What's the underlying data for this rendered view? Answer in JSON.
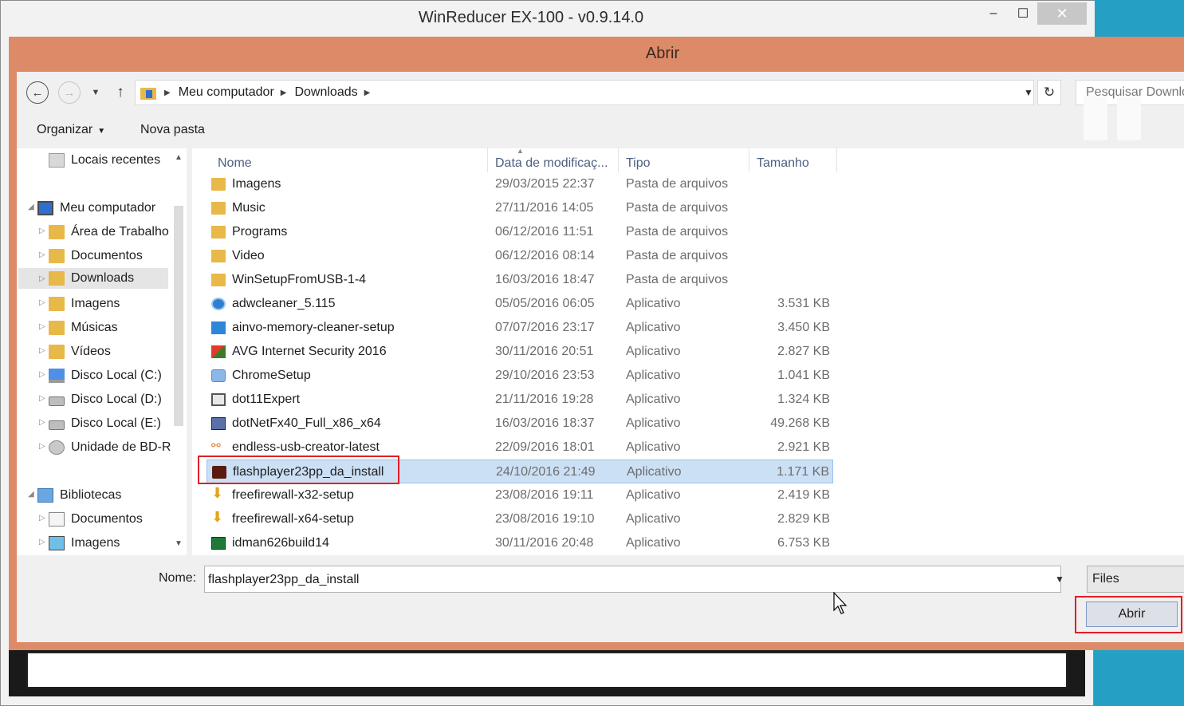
{
  "app": {
    "title": "WinReducer EX-100 - v0.9.14.0",
    "buttons": {
      "minimize": "–",
      "maximize": "☐",
      "close": "✕"
    }
  },
  "dialog": {
    "title": "Abrir",
    "address": {
      "crumbs": [
        "Meu computador",
        "Downloads"
      ]
    },
    "search_placeholder": "Pesquisar Downloads",
    "toolbar": {
      "organize": "Organizar",
      "new_folder": "Nova pasta"
    },
    "nav_pane": {
      "items": [
        {
          "label": "Locais recentes",
          "icon": "recent-places-icon"
        },
        {
          "label": "Meu computador",
          "icon": "computer-icon"
        },
        {
          "label": "Área de Trabalho",
          "icon": "desktop-folder-icon"
        },
        {
          "label": "Documentos",
          "icon": "documents-folder-icon"
        },
        {
          "label": "Downloads",
          "icon": "downloads-folder-icon",
          "selected": true
        },
        {
          "label": "Imagens",
          "icon": "pictures-folder-icon"
        },
        {
          "label": "Músicas",
          "icon": "music-folder-icon"
        },
        {
          "label": "Vídeos",
          "icon": "videos-folder-icon"
        },
        {
          "label": "Disco Local (C:)",
          "icon": "system-drive-icon"
        },
        {
          "label": "Disco Local (D:)",
          "icon": "drive-icon"
        },
        {
          "label": "Disco Local (E:)",
          "icon": "drive-icon"
        },
        {
          "label": "Unidade de BD-R",
          "icon": "disc-drive-icon"
        },
        {
          "label": "Bibliotecas",
          "icon": "libraries-icon"
        },
        {
          "label": "Documentos",
          "icon": "documents-library-icon"
        },
        {
          "label": "Imagens",
          "icon": "pictures-library-icon"
        }
      ]
    },
    "columns": {
      "name": "Nome",
      "date": "Data de modificaç...",
      "type": "Tipo",
      "size": "Tamanho"
    },
    "files": [
      {
        "name": "Imagens",
        "date": "29/03/2015 22:37",
        "type": "Pasta de arquivos",
        "size": "",
        "icon": "folder-icon"
      },
      {
        "name": "Music",
        "date": "27/11/2016 14:05",
        "type": "Pasta de arquivos",
        "size": "",
        "icon": "folder-icon"
      },
      {
        "name": "Programs",
        "date": "06/12/2016 11:51",
        "type": "Pasta de arquivos",
        "size": "",
        "icon": "folder-icon"
      },
      {
        "name": "Video",
        "date": "06/12/2016 08:14",
        "type": "Pasta de arquivos",
        "size": "",
        "icon": "folder-icon"
      },
      {
        "name": "WinSetupFromUSB-1-4",
        "date": "16/03/2016 18:47",
        "type": "Pasta de arquivos",
        "size": "",
        "icon": "folder-icon"
      },
      {
        "name": "adwcleaner_5.115",
        "date": "05/05/2016 06:05",
        "type": "Aplicativo",
        "size": "3.531 KB",
        "icon": "adwcleaner-icon"
      },
      {
        "name": "ainvo-memory-cleaner-setup",
        "date": "07/07/2016 23:17",
        "type": "Aplicativo",
        "size": "3.450 KB",
        "icon": "memory-cleaner-icon"
      },
      {
        "name": "AVG Internet Security 2016",
        "date": "30/11/2016 20:51",
        "type": "Aplicativo",
        "size": "2.827 KB",
        "icon": "avg-icon"
      },
      {
        "name": "ChromeSetup",
        "date": "29/10/2016 23:53",
        "type": "Aplicativo",
        "size": "1.041 KB",
        "icon": "chrome-setup-icon"
      },
      {
        "name": "dot11Expert",
        "date": "21/11/2016 19:28",
        "type": "Aplicativo",
        "size": "1.324 KB",
        "icon": "application-icon"
      },
      {
        "name": "dotNetFx40_Full_x86_x64",
        "date": "16/03/2016 18:37",
        "type": "Aplicativo",
        "size": "49.268 KB",
        "icon": "dotnet-installer-icon"
      },
      {
        "name": "endless-usb-creator-latest",
        "date": "22/09/2016 18:01",
        "type": "Aplicativo",
        "size": "2.921 KB",
        "icon": "usb-creator-icon"
      },
      {
        "name": "flashplayer23pp_da_install",
        "date": "24/10/2016 21:49",
        "type": "Aplicativo",
        "size": "1.171 KB",
        "icon": "flash-player-icon",
        "selected": true
      },
      {
        "name": "freefirewall-x32-setup",
        "date": "23/08/2016 19:11",
        "type": "Aplicativo",
        "size": "2.419 KB",
        "icon": "download-arrow-icon"
      },
      {
        "name": "freefirewall-x64-setup",
        "date": "23/08/2016 19:10",
        "type": "Aplicativo",
        "size": "2.829 KB",
        "icon": "download-arrow-icon"
      },
      {
        "name": "idman626build14",
        "date": "30/11/2016 20:48",
        "type": "Aplicativo",
        "size": "6.753 KB",
        "icon": "idm-icon"
      }
    ],
    "filename": {
      "label": "Nome:",
      "value": "flashplayer23pp_da_install"
    },
    "filetype": "Files",
    "open_button": "Abrir"
  },
  "colors": {
    "dialog_frame": "#dd8a68",
    "selection": "#cce0f5",
    "highlight_box": "#e01f26",
    "desktop": "#1f8bb3"
  }
}
